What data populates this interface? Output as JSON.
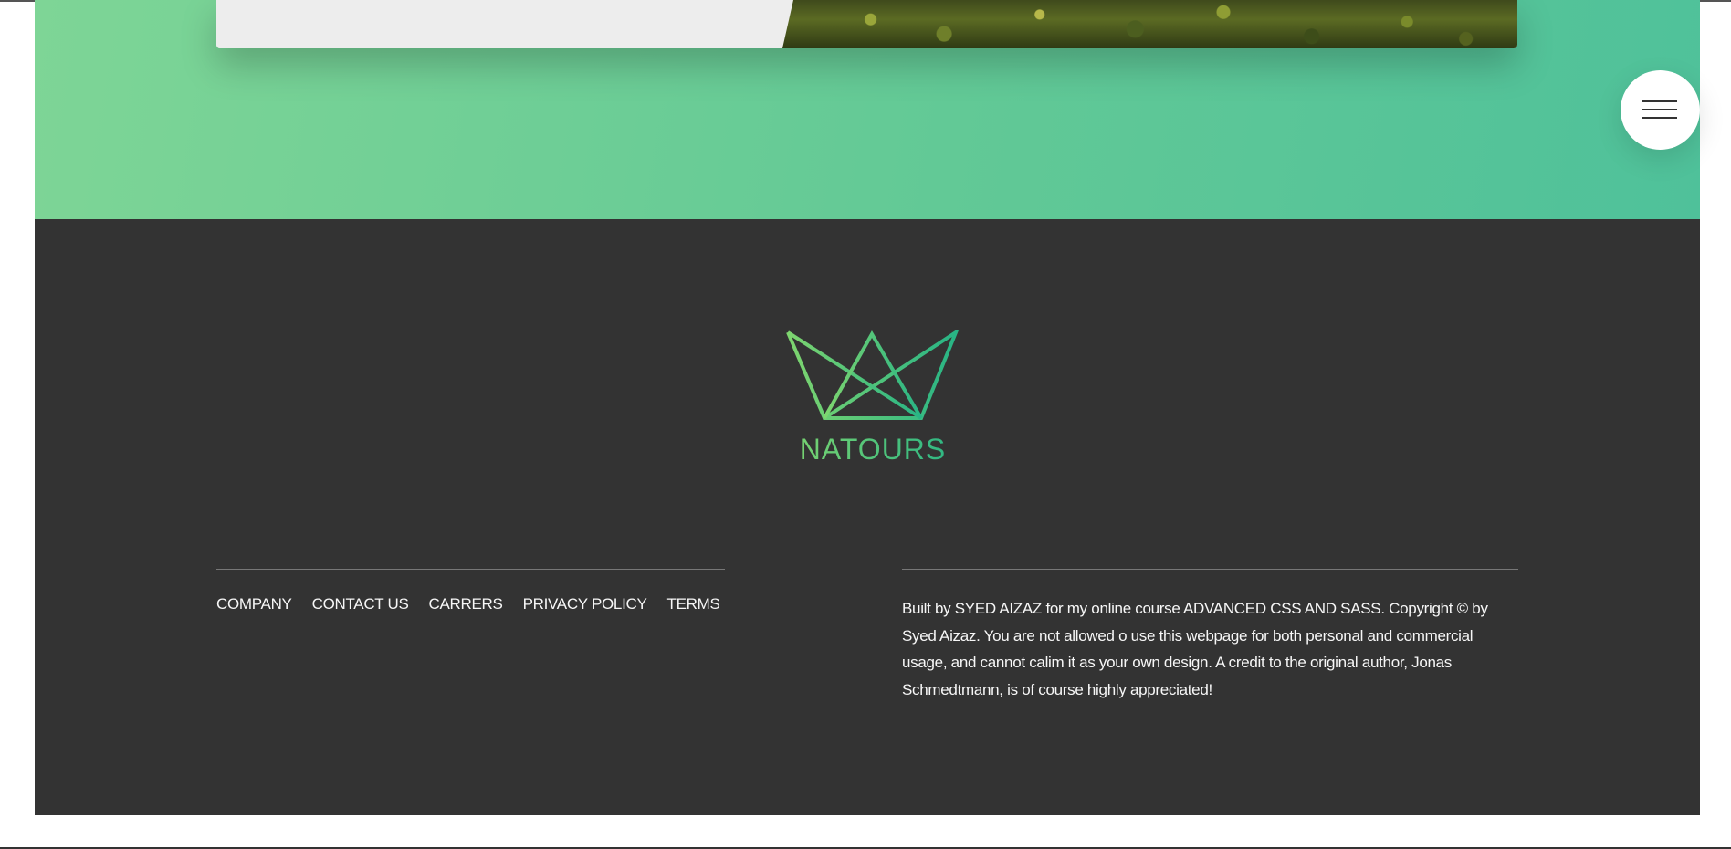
{
  "navigation": {
    "menu_button_icon": "hamburger-menu-icon"
  },
  "footer": {
    "logo": {
      "icon": "crown-logo-icon",
      "text": "NATOURS",
      "gradient_start": "#7ed56f",
      "gradient_end": "#28b485"
    },
    "links": [
      {
        "label": "COMPANY"
      },
      {
        "label": "CONTACT US"
      },
      {
        "label": "CARRERS"
      },
      {
        "label": "PRIVACY POLICY"
      },
      {
        "label": "TERMS"
      }
    ],
    "copyright": "Built by SYED AIZAZ for my online course ADVANCED CSS AND SASS. Copyright © by Syed Aizaz. You are not allowed o use this webpage for both personal and commercial usage, and cannot calim it as your own design. A credit to the original author, Jonas Schmedtmann, is of course highly appreciated!"
  },
  "colors": {
    "primary_light": "#7ed56f",
    "primary": "#55c57a",
    "primary_dark": "#28b485",
    "footer_bg": "#333333",
    "text_light": "#f7f7f7"
  }
}
